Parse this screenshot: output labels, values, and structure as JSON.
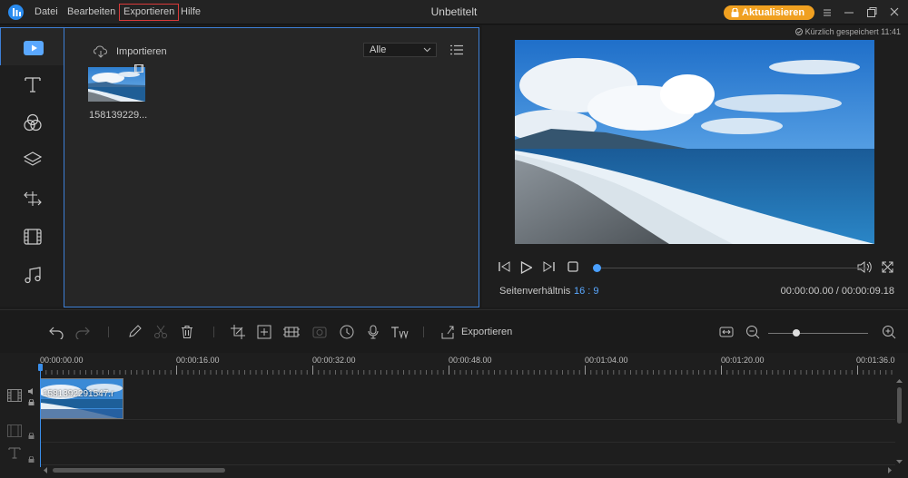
{
  "titlebar": {
    "title": "Unbetitelt",
    "menu": [
      "Datei",
      "Bearbeiten",
      "Exportieren",
      "Hilfe"
    ],
    "upgrade_label": "Aktualisieren",
    "accent_color": "#f0a020"
  },
  "tools": [
    "media-icon",
    "text-icon",
    "filter-icon",
    "overlay-icon",
    "transition-icon",
    "element-icon",
    "music-icon"
  ],
  "media_panel": {
    "import_label": "Importieren",
    "filter_value": "Alle",
    "items": [
      {
        "name": "158139229..."
      }
    ]
  },
  "preview": {
    "saved_status": "Kürzlich gespeichert 11:41",
    "aspect_label": "Seitenverhältnis",
    "aspect_value": "16 : 9",
    "time_display": "00:00:00.00 / 00:00:09.18",
    "progress": 0
  },
  "toolbar": {
    "export_label": "Exportieren"
  },
  "timeline": {
    "ruler": [
      "00:00:00.00",
      "00:00:16.00",
      "00:00:32.00",
      "00:00:48.00",
      "00:01:04.00",
      "00:01:20.00",
      "00:01:36.0"
    ],
    "clip_label": "1581392291547.r"
  }
}
